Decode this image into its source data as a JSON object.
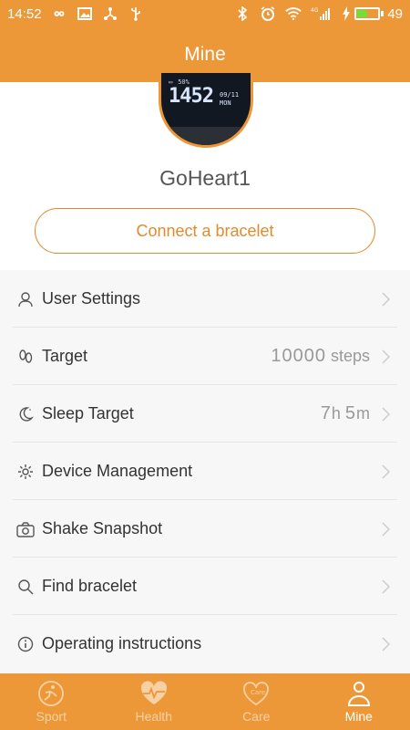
{
  "status_bar": {
    "time": "14:52",
    "battery_level": "49",
    "network_badge": "4G"
  },
  "header": {
    "title": "Mine"
  },
  "profile": {
    "username": "GoHeart1",
    "connect_label": "Connect a bracelet",
    "watch": {
      "battery": "50%",
      "time": "1452",
      "date": "09/11",
      "day": "MON"
    }
  },
  "menu": {
    "items": [
      {
        "label": "User Settings",
        "icon": "user-icon"
      },
      {
        "label": "Target",
        "icon": "footprints-icon",
        "value_number": "10000",
        "value_unit": "steps"
      },
      {
        "label": "Sleep Target",
        "icon": "moon-icon",
        "value_number": "7",
        "value_unit_h": "h",
        "value_number2": "5",
        "value_unit_m": "m"
      },
      {
        "label": "Device Management",
        "icon": "gear-icon"
      },
      {
        "label": "Shake Snapshot",
        "icon": "camera-icon"
      },
      {
        "label": "Find bracelet",
        "icon": "search-icon"
      },
      {
        "label": "Operating instructions",
        "icon": "info-icon"
      }
    ]
  },
  "tabs": [
    {
      "label": "Sport",
      "icon": "runner-icon",
      "active": false
    },
    {
      "label": "Health",
      "icon": "heartbeat-icon",
      "active": false
    },
    {
      "label": "Care",
      "icon": "care-heart-icon",
      "active": false
    },
    {
      "label": "Mine",
      "icon": "person-icon",
      "active": true
    }
  ],
  "colors": {
    "accent": "#ed9838",
    "button_text": "#e38a2c"
  }
}
